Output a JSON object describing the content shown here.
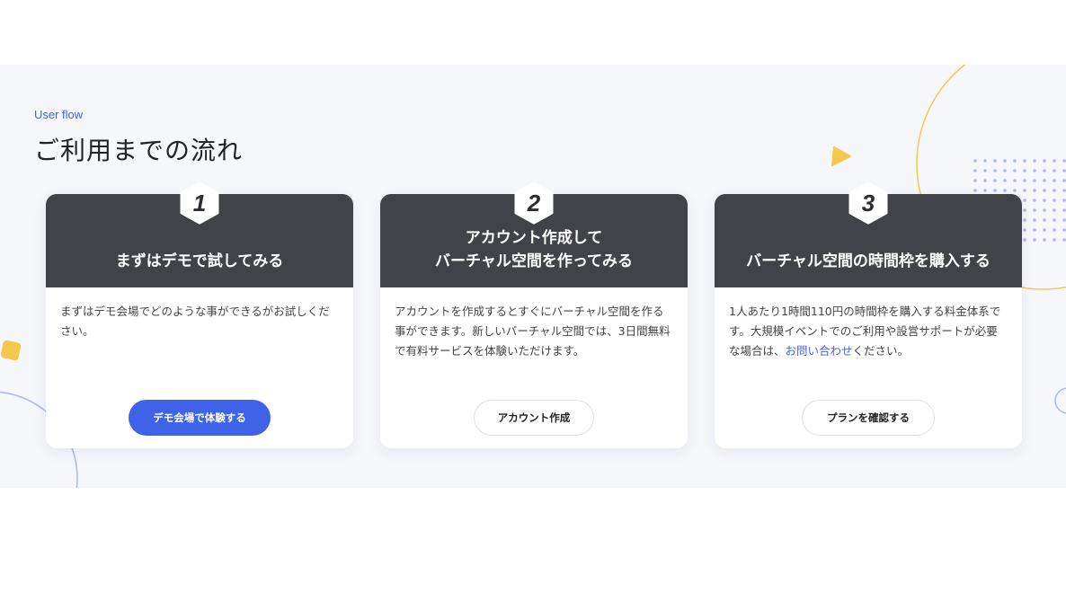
{
  "section": {
    "eyebrow": "User flow",
    "title": "ご利用までの流れ"
  },
  "colors": {
    "accent": "#3f63e8",
    "card_header": "#424349",
    "section_bg": "#f6f7fb",
    "deco_yellow": "#f2c94c"
  },
  "cards": [
    {
      "step": "1",
      "title": "まずはデモで試してみる",
      "description": "まずはデモ会場でどのような事ができるがお試しください。",
      "button": "デモ会場で体験する"
    },
    {
      "step": "2",
      "title": "アカウント作成して\nバーチャル空間を作ってみる",
      "description": "アカウントを作成するとすぐにバーチャル空間を作る事ができます。新しいバーチャル空間では、3日間無料で有料サービスを体験いただけます。",
      "button": "アカウント作成"
    },
    {
      "step": "3",
      "title": "バーチャル空間の時間枠を購入する",
      "description_before": "1人あたり1時間110円の時間枠を購入する料金体系です。大規模イベントでのご利用や設営サポートが必要な場合は、",
      "description_link": "お問い合わせ",
      "description_after": "ください。",
      "button": "プランを確認する"
    }
  ]
}
